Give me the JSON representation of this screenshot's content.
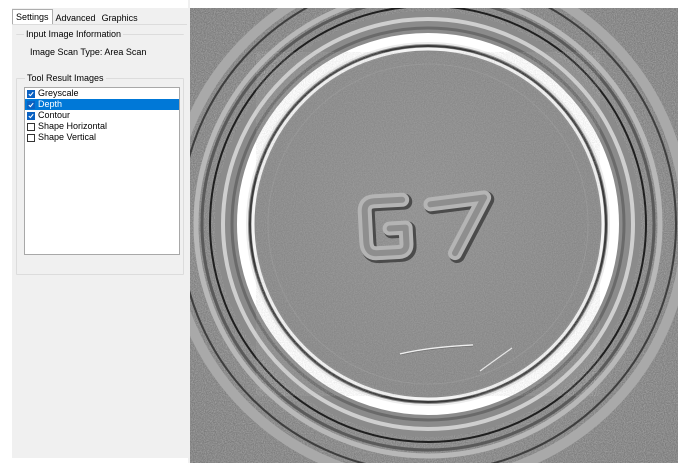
{
  "tabs": [
    {
      "label": "Settings",
      "active": true
    },
    {
      "label": "Advanced",
      "active": false
    },
    {
      "label": "Graphics",
      "active": false
    }
  ],
  "input_group": {
    "title": "Input Image Information",
    "scan_type": "Image Scan Type: Area Scan"
  },
  "tool_group": {
    "title": "Tool Result Images",
    "items": [
      {
        "label": "Greyscale",
        "checked": true,
        "selected": false
      },
      {
        "label": "Depth",
        "checked": true,
        "selected": true
      },
      {
        "label": "Contour",
        "checked": true,
        "selected": false
      },
      {
        "label": "Shape Horizontal",
        "checked": false,
        "selected": false
      },
      {
        "label": "Shape Vertical",
        "checked": false,
        "selected": false
      }
    ]
  },
  "image": {
    "embossed_text": "G7"
  },
  "colors": {
    "selection": "#0078d7",
    "checkbox": "#0a61c2",
    "panel_bg": "#f0f0f0"
  }
}
